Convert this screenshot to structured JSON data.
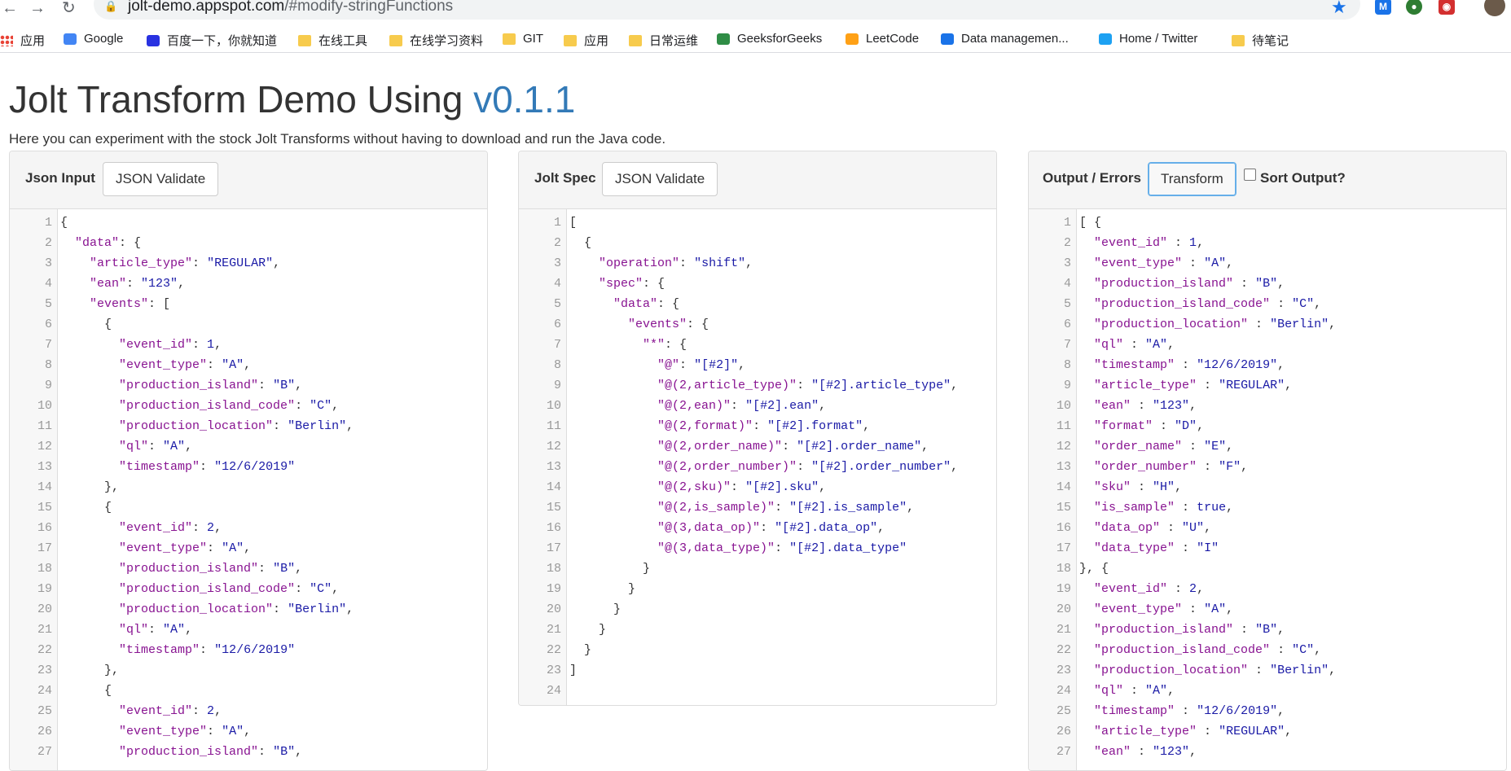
{
  "browser": {
    "url_host": "jolt-demo.appspot.com",
    "url_path": "/#modify-stringFunctions",
    "bookmarks": [
      {
        "label": "应用",
        "icon": "apps-grid-icon"
      },
      {
        "label": "Google",
        "icon": "google-icon"
      },
      {
        "label": "百度一下，你就知道",
        "icon": "baidu-icon"
      },
      {
        "label": "在线工具",
        "icon": "folder-icon"
      },
      {
        "label": "在线学习资料",
        "icon": "folder-icon"
      },
      {
        "label": "GIT",
        "icon": "folder-icon"
      },
      {
        "label": "应用",
        "icon": "folder-icon"
      },
      {
        "label": "日常运维",
        "icon": "folder-icon"
      },
      {
        "label": "GeeksforGeeks",
        "icon": "geeksforgeeks-icon"
      },
      {
        "label": "LeetCode",
        "icon": "leetcode-icon"
      },
      {
        "label": "Data managemen...",
        "icon": "l-icon"
      },
      {
        "label": "Home / Twitter",
        "icon": "twitter-icon"
      },
      {
        "label": "待笔记",
        "icon": "folder-icon"
      }
    ]
  },
  "page": {
    "title_main": "Jolt Transform Demo Using ",
    "title_version": "v0.1.1",
    "subtitle": "Here you can experiment with the stock Jolt Transforms without having to download and run the Java code."
  },
  "panels": {
    "input": {
      "label": "Json Input",
      "button": "JSON Validate"
    },
    "spec": {
      "label": "Jolt Spec",
      "button": "JSON Validate"
    },
    "output": {
      "label": "Output / Errors",
      "button": "Transform",
      "checkbox_label": "Sort Output?"
    }
  },
  "editors": {
    "input": [
      "{",
      "  \"data\": {",
      "    \"article_type\": \"REGULAR\",",
      "    \"ean\": \"123\",",
      "    \"events\": [",
      "      {",
      "        \"event_id\": 1,",
      "        \"event_type\": \"A\",",
      "        \"production_island\": \"B\",",
      "        \"production_island_code\": \"C\",",
      "        \"production_location\": \"Berlin\",",
      "        \"ql\": \"A\",",
      "        \"timestamp\": \"12/6/2019\"",
      "      },",
      "      {",
      "        \"event_id\": 2,",
      "        \"event_type\": \"A\",",
      "        \"production_island\": \"B\",",
      "        \"production_island_code\": \"C\",",
      "        \"production_location\": \"Berlin\",",
      "        \"ql\": \"A\",",
      "        \"timestamp\": \"12/6/2019\"",
      "      },",
      "      {",
      "        \"event_id\": 2,",
      "        \"event_type\": \"A\",",
      "        \"production_island\": \"B\","
    ],
    "spec": [
      "[",
      "  {",
      "    \"operation\": \"shift\",",
      "    \"spec\": {",
      "      \"data\": {",
      "        \"events\": {",
      "          \"*\": {",
      "            \"@\": \"[#2]\",",
      "            \"@(2,article_type)\": \"[#2].article_type\",",
      "            \"@(2,ean)\": \"[#2].ean\",",
      "            \"@(2,format)\": \"[#2].format\",",
      "            \"@(2,order_name)\": \"[#2].order_name\",",
      "            \"@(2,order_number)\": \"[#2].order_number\",",
      "            \"@(2,sku)\": \"[#2].sku\",",
      "            \"@(2,is_sample)\": \"[#2].is_sample\",",
      "            \"@(3,data_op)\": \"[#2].data_op\",",
      "            \"@(3,data_type)\": \"[#2].data_type\"",
      "          }",
      "        }",
      "      }",
      "    }",
      "  }",
      "]",
      ""
    ],
    "output": [
      "[ {",
      "  \"event_id\" : 1,",
      "  \"event_type\" : \"A\",",
      "  \"production_island\" : \"B\",",
      "  \"production_island_code\" : \"C\",",
      "  \"production_location\" : \"Berlin\",",
      "  \"ql\" : \"A\",",
      "  \"timestamp\" : \"12/6/2019\",",
      "  \"article_type\" : \"REGULAR\",",
      "  \"ean\" : \"123\",",
      "  \"format\" : \"D\",",
      "  \"order_name\" : \"E\",",
      "  \"order_number\" : \"F\",",
      "  \"sku\" : \"H\",",
      "  \"is_sample\" : true,",
      "  \"data_op\" : \"U\",",
      "  \"data_type\" : \"I\"",
      "}, {",
      "  \"event_id\" : 2,",
      "  \"event_type\" : \"A\",",
      "  \"production_island\" : \"B\",",
      "  \"production_island_code\" : \"C\",",
      "  \"production_location\" : \"Berlin\",",
      "  \"ql\" : \"A\",",
      "  \"timestamp\" : \"12/6/2019\",",
      "  \"article_type\" : \"REGULAR\",",
      "  \"ean\" : \"123\","
    ]
  },
  "colors": {
    "link_blue": "#337ab7",
    "json_key": "#881391",
    "json_string": "#1a1aa6"
  }
}
